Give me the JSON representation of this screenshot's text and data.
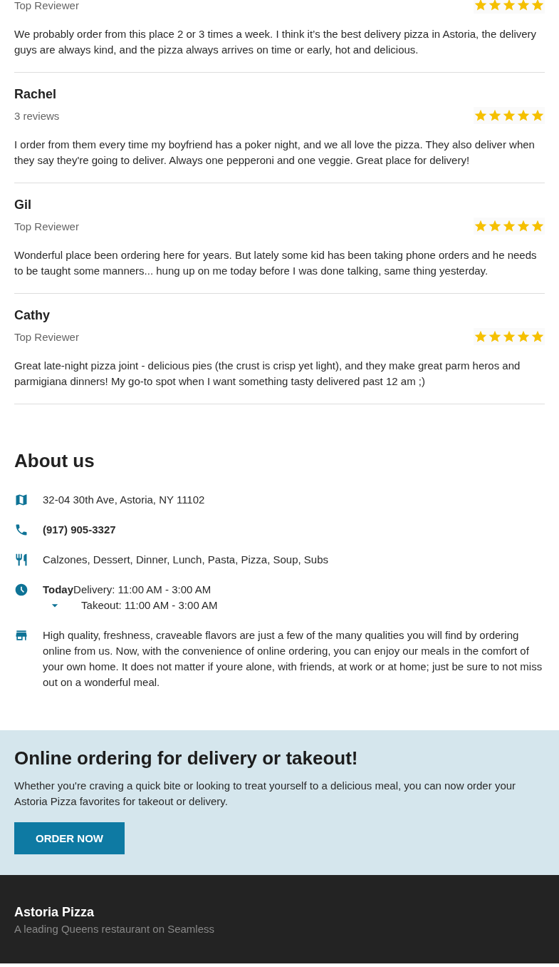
{
  "reviews": [
    {
      "subtitle": "Top Reviewer",
      "stars": 5,
      "text": "We probably order from this place 2 or 3 times a week. I think it’s the best delivery pizza in Astoria, the delivery guys are always kind, and the pizza always arrives on time or early, hot and delicious."
    },
    {
      "name": "Rachel",
      "subtitle": "3 reviews",
      "stars": 5,
      "text": "I order from them every time my boyfriend has a poker night, and we all love the pizza. They also deliver when they say they're going to deliver. Always one pepperoni and one veggie. Great place for delivery!"
    },
    {
      "name": "Gil",
      "subtitle": "Top Reviewer",
      "stars": 5,
      "text": "Wonderful place been ordering here for years. But lately some kid has been taking phone orders and he needs to be taught some manners... hung up on me today before I was done talking, same thing yesterday."
    },
    {
      "name": "Cathy",
      "subtitle": "Top Reviewer",
      "stars": 5,
      "text": "Great late-night pizza joint - delicious pies (the crust is crisp yet light), and they make great parm heros and parmigiana dinners! My go-to spot when I want something tasty delivered past 12 am ;)"
    }
  ],
  "about": {
    "title": "About us",
    "items": [
      {
        "kind": "address",
        "text": "32-04 30th Ave, Astoria, NY 11102"
      },
      {
        "kind": "phone",
        "text": "(917) 905-3327"
      },
      {
        "kind": "cuisine",
        "text": "Calzones, Dessert, Dinner, Lunch, Pasta, Pizza, Soup, Subs"
      },
      {
        "kind": "hours",
        "day": "Today",
        "expanded": false,
        "lines": [
          "Delivery: 11:00 AM - 3:00 AM",
          "Takeout: 11:00 AM - 3:00 AM"
        ]
      },
      {
        "kind": "description",
        "text": "High quality, freshness, craveable flavors are just a few of the many qualities you will find by ordering online from us. Now, with the convenience of online ordering, you can enjoy our meals in the comfort of your own home. It does not matter if youre alone, with friends, at work or at home; just be sure to not miss out on a wonderful meal."
      }
    ]
  },
  "promo": {
    "title": "Online ordering for delivery or takeout!",
    "text": "Whether you're craving a quick bite or looking to treat yourself to a delicious meal, you can now order your Astoria Pizza favorites for takeout or delivery.",
    "button": "ORDER NOW"
  },
  "footer": {
    "name": "Astoria Pizza",
    "tagline": "A leading Queens restaurant on Seamless"
  }
}
